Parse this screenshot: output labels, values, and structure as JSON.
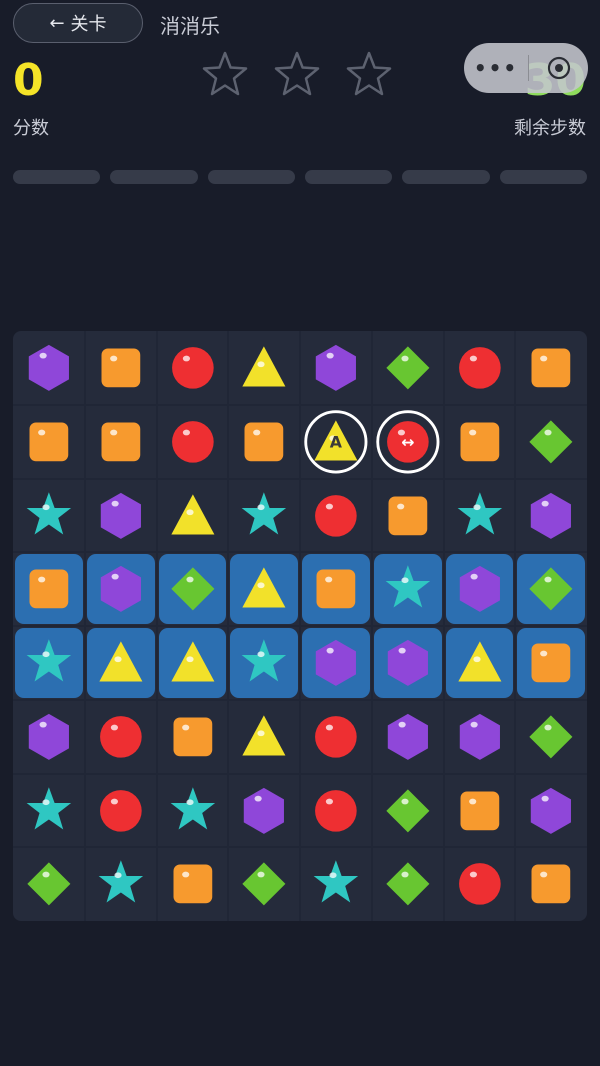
{
  "header": {
    "back_label": "关卡",
    "title": "消消乐"
  },
  "score": {
    "value": "0",
    "label": "分数"
  },
  "stars": {
    "earned": 0,
    "total": 3
  },
  "moves": {
    "value": "30",
    "label": "剩余步数"
  },
  "capsule": {
    "menu_icon": "more-dots-icon",
    "close_icon": "target-close-icon"
  },
  "progress": {
    "segments": 6,
    "filled": 0
  },
  "colors": {
    "purple": "#8f47d9",
    "orange": "#f79a2e",
    "red": "#ee2f32",
    "yellow": "#f2e12a",
    "green": "#68c631",
    "cyan": "#2fc7c2",
    "highlight": "#2c6fb1"
  },
  "board": {
    "cols": 8,
    "rows": 8,
    "cells": [
      [
        "hexagon",
        "square",
        "circle",
        "triangle",
        "hexagon",
        "diamond",
        "circle",
        "square"
      ],
      [
        "square",
        "square",
        "circle",
        "square",
        "triangle",
        "circle",
        "square",
        "diamond"
      ],
      [
        "star",
        "hexagon",
        "triangle",
        "star",
        "circle",
        "square",
        "star",
        "hexagon"
      ],
      [
        "square",
        "hexagon",
        "diamond",
        "triangle",
        "square",
        "star",
        "hexagon",
        "diamond"
      ],
      [
        "star",
        "triangle",
        "triangle",
        "star",
        "hexagon",
        "hexagon",
        "triangle",
        "square"
      ],
      [
        "hexagon",
        "circle",
        "square",
        "triangle",
        "circle",
        "hexagon",
        "hexagon",
        "diamond"
      ],
      [
        "star",
        "circle",
        "star",
        "hexagon",
        "circle",
        "diamond",
        "square",
        "hexagon"
      ],
      [
        "diamond",
        "star",
        "square",
        "diamond",
        "star",
        "diamond",
        "circle",
        "square"
      ]
    ],
    "highlighted_rows": [
      3,
      4
    ],
    "specials": [
      {
        "row": 1,
        "col": 4,
        "label": "A"
      },
      {
        "row": 1,
        "col": 5,
        "label": "↔"
      }
    ]
  }
}
